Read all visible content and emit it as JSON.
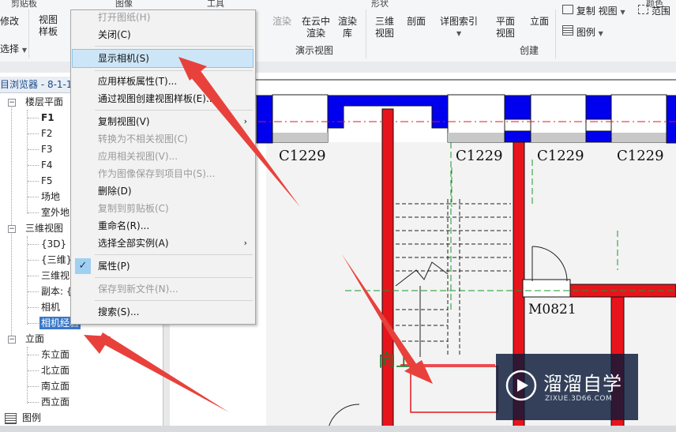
{
  "ribbon": {
    "group_titles": [
      "剪贴板",
      "图像",
      "工具",
      "形状",
      "颜色"
    ],
    "modify_label": "修改",
    "select_label": "选择",
    "view_template_label": "视图\n样板",
    "render_label": "渲染",
    "render_in_cloud_label": "在云中\n渲染",
    "render_gallery_label": "渲染\n库",
    "presentation_view_label": "演示视图",
    "3d_view_label": "三维\n视图",
    "section_label": "剖面",
    "callout_label": "详图索引",
    "plan_view_label": "平面\n视图",
    "elevation_label": "立面",
    "create_label": "创建",
    "duplicate_view_label": "复制 视图",
    "legend_label": "图例",
    "range_label": "范围"
  },
  "browser": {
    "title": "目浏览器 - 8-1-1",
    "floor_plans_label": "楼层平面",
    "floor_plans": [
      "F1",
      "F2",
      "F3",
      "F4",
      "F5",
      "场地",
      "室外地"
    ],
    "views_3d_label": "三维视图",
    "views_3d": [
      "{3D}",
      "{三维}",
      "三维视",
      "副本: {",
      "相机",
      "相机经验"
    ],
    "selected_item": "相机经验",
    "elevations_label": "立面",
    "elevations": [
      "东立面",
      "北立面",
      "南立面",
      "西立面"
    ],
    "legend_label": "图例"
  },
  "context_menu": {
    "items": [
      {
        "label": "打开图纸(H)",
        "enabled": false
      },
      {
        "label": "关闭(C)",
        "enabled": true
      },
      {
        "label": "显示相机(S)",
        "enabled": true,
        "highlighted": true
      },
      {
        "label": "应用样板属性(T)...",
        "enabled": true
      },
      {
        "label": "通过视图创建视图样板(E)...",
        "enabled": true
      },
      {
        "label": "复制视图(V)",
        "enabled": true,
        "submenu": true
      },
      {
        "label": "转换为不相关视图(C)",
        "enabled": false
      },
      {
        "label": "应用相关视图(V)...",
        "enabled": false
      },
      {
        "label": "作为图像保存到项目中(S)...",
        "enabled": false
      },
      {
        "label": "删除(D)",
        "enabled": true
      },
      {
        "label": "复制到剪贴板(C)",
        "enabled": false
      },
      {
        "label": "重命名(R)...",
        "enabled": true
      },
      {
        "label": "选择全部实例(A)",
        "enabled": true,
        "submenu": true
      },
      {
        "label": "属性(P)",
        "enabled": true,
        "checked": true
      },
      {
        "label": "保存到新文件(N)...",
        "enabled": false
      },
      {
        "label": "搜索(S)...",
        "enabled": true
      }
    ],
    "submenu_glyph": "›",
    "check_glyph": "✓"
  },
  "drawing": {
    "tags": [
      "C1229",
      "C1229",
      "C1229",
      "C1229",
      "M0821"
    ],
    "green_label": "向上"
  },
  "watermark": {
    "title": "溜溜自学",
    "subtitle": "ZIXUE.3D66.COM"
  },
  "colors": {
    "wall_blue": "#0000ee",
    "wall_red": "#e8141c",
    "arrow_red": "#e8413c",
    "highlight": "#cde6f7",
    "tree_selection": "#3a78c8",
    "watermark_bg": "#0a1937"
  }
}
